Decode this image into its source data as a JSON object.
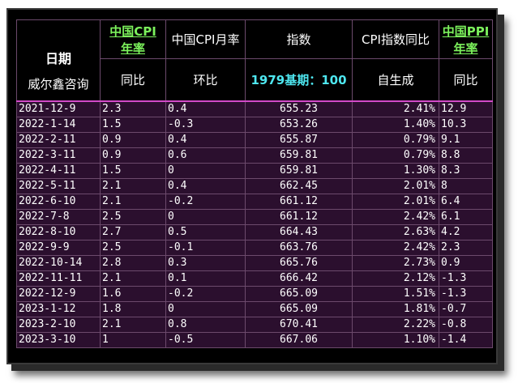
{
  "header": {
    "date_label": "日期",
    "source_label": "威尔鑫咨询",
    "col_cpi_yoy_top_a": "中国CPI",
    "col_cpi_yoy_top_b": "年率",
    "col_cpi_mom_top": "中国CPI月率",
    "col_index_top": "指数",
    "col_index_yoy_top": "CPI指数同比",
    "col_ppi_top_a": "中国PPI",
    "col_ppi_top_b": "年率",
    "col_cpi_yoy_sub": "同比",
    "col_cpi_mom_sub": "环比",
    "col_index_sub": "1979基期：100",
    "col_index_yoy_sub": "自生成",
    "col_ppi_sub": "同比"
  },
  "colors": {
    "green_header": "#7cf25c",
    "cyan_header": "#4ee7f0",
    "row_bg": "#2b0f2e",
    "separator": "#d24ac8"
  },
  "rows": [
    {
      "date": "2021-12-9",
      "cpi_yoy": "2.3",
      "cpi_mom": "0.4",
      "index": "655.23",
      "index_yoy": "2.41%",
      "ppi_yoy": "12.9"
    },
    {
      "date": "2022-1-14",
      "cpi_yoy": "1.5",
      "cpi_mom": "-0.3",
      "index": "653.26",
      "index_yoy": "1.40%",
      "ppi_yoy": "10.3"
    },
    {
      "date": "2022-2-11",
      "cpi_yoy": "0.9",
      "cpi_mom": "0.4",
      "index": "655.87",
      "index_yoy": "0.79%",
      "ppi_yoy": "9.1"
    },
    {
      "date": "2022-3-11",
      "cpi_yoy": "0.9",
      "cpi_mom": "0.6",
      "index": "659.81",
      "index_yoy": "0.79%",
      "ppi_yoy": "8.8"
    },
    {
      "date": "2022-4-11",
      "cpi_yoy": "1.5",
      "cpi_mom": "0",
      "index": "659.81",
      "index_yoy": "1.30%",
      "ppi_yoy": "8.3"
    },
    {
      "date": "2022-5-11",
      "cpi_yoy": "2.1",
      "cpi_mom": "0.4",
      "index": "662.45",
      "index_yoy": "2.01%",
      "ppi_yoy": "8"
    },
    {
      "date": "2022-6-10",
      "cpi_yoy": "2.1",
      "cpi_mom": "-0.2",
      "index": "661.12",
      "index_yoy": "2.01%",
      "ppi_yoy": "6.4"
    },
    {
      "date": "2022-7-8",
      "cpi_yoy": "2.5",
      "cpi_mom": "0",
      "index": "661.12",
      "index_yoy": "2.42%",
      "ppi_yoy": "6.1"
    },
    {
      "date": "2022-8-10",
      "cpi_yoy": "2.7",
      "cpi_mom": "0.5",
      "index": "664.43",
      "index_yoy": "2.63%",
      "ppi_yoy": "4.2"
    },
    {
      "date": "2022-9-9",
      "cpi_yoy": "2.5",
      "cpi_mom": "-0.1",
      "index": "663.76",
      "index_yoy": "2.42%",
      "ppi_yoy": "2.3"
    },
    {
      "date": "2022-10-14",
      "cpi_yoy": "2.8",
      "cpi_mom": "0.3",
      "index": "665.76",
      "index_yoy": "2.73%",
      "ppi_yoy": "0.9"
    },
    {
      "date": "2022-11-11",
      "cpi_yoy": "2.1",
      "cpi_mom": "0.1",
      "index": "666.42",
      "index_yoy": "2.12%",
      "ppi_yoy": "-1.3"
    },
    {
      "date": "2022-12-9",
      "cpi_yoy": "1.6",
      "cpi_mom": "-0.2",
      "index": "665.09",
      "index_yoy": "1.51%",
      "ppi_yoy": "-1.3"
    },
    {
      "date": "2023-1-12",
      "cpi_yoy": "1.8",
      "cpi_mom": "0",
      "index": "665.09",
      "index_yoy": "1.81%",
      "ppi_yoy": "-0.7"
    },
    {
      "date": "2023-2-10",
      "cpi_yoy": "2.1",
      "cpi_mom": "0.8",
      "index": "670.41",
      "index_yoy": "2.22%",
      "ppi_yoy": "-0.8"
    },
    {
      "date": "2023-3-10",
      "cpi_yoy": "1",
      "cpi_mom": "-0.5",
      "index": "667.06",
      "index_yoy": "1.10%",
      "ppi_yoy": "-1.4"
    }
  ]
}
